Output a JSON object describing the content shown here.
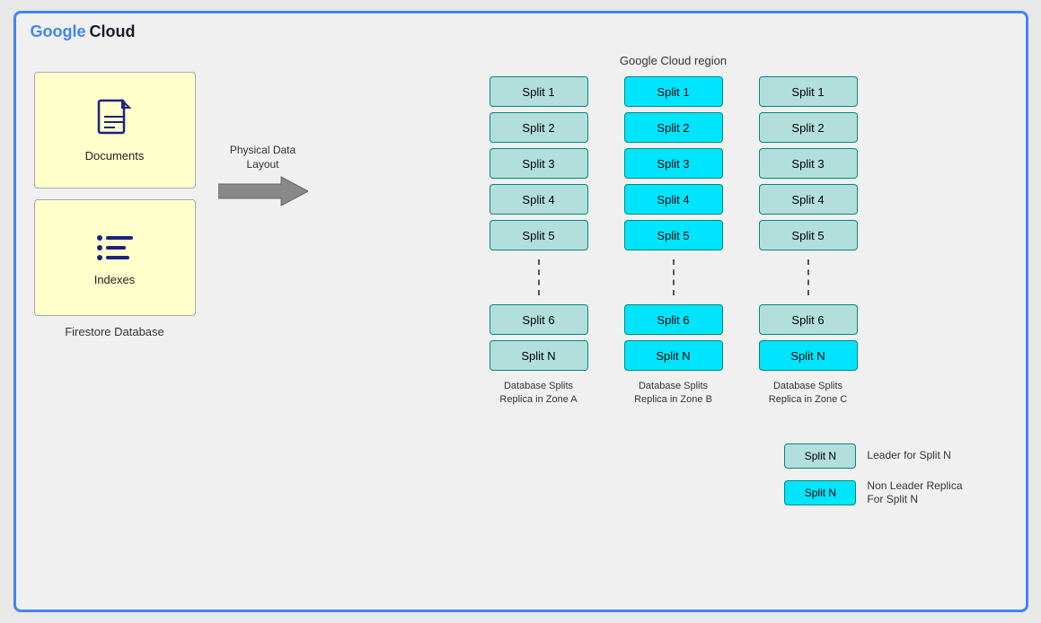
{
  "header": {
    "google": "Google",
    "cloud": "Cloud"
  },
  "region": {
    "label": "Google Cloud region"
  },
  "leftPanel": {
    "documents": {
      "label": "Documents"
    },
    "indexes": {
      "label": "Indexes"
    },
    "firestoreLabel": "Firestore Database"
  },
  "arrow": {
    "label": "Physical Data\nLayout"
  },
  "zones": [
    {
      "id": "zone-a",
      "splits": [
        "Split 1",
        "Split 2",
        "Split 3",
        "Split 4",
        "Split 5",
        "Split 6",
        "Split N"
      ],
      "types": [
        "leader",
        "leader",
        "leader",
        "leader",
        "leader",
        "leader",
        "leader"
      ],
      "label": "Database Splits\nReplica in Zone A"
    },
    {
      "id": "zone-b",
      "splits": [
        "Split 1",
        "Split 2",
        "Split 3",
        "Split 4",
        "Split 5",
        "Split 6",
        "Split N"
      ],
      "types": [
        "nonleader",
        "nonleader",
        "nonleader",
        "nonleader",
        "nonleader",
        "nonleader",
        "nonleader"
      ],
      "label": "Database Splits\nReplica in Zone B"
    },
    {
      "id": "zone-c",
      "splits": [
        "Split 1",
        "Split 2",
        "Split 3",
        "Split 4",
        "Split 5",
        "Split 6",
        "Split N"
      ],
      "types": [
        "leader",
        "leader",
        "leader",
        "leader",
        "leader",
        "leader",
        "nonleader"
      ],
      "label": "Database Splits\nReplica in Zone C"
    }
  ],
  "legend": [
    {
      "type": "leader",
      "boxLabel": "Split N",
      "description": "Leader for Split N"
    },
    {
      "type": "nonleader",
      "boxLabel": "Split N",
      "description": "Non Leader Replica\nFor Split N"
    }
  ]
}
